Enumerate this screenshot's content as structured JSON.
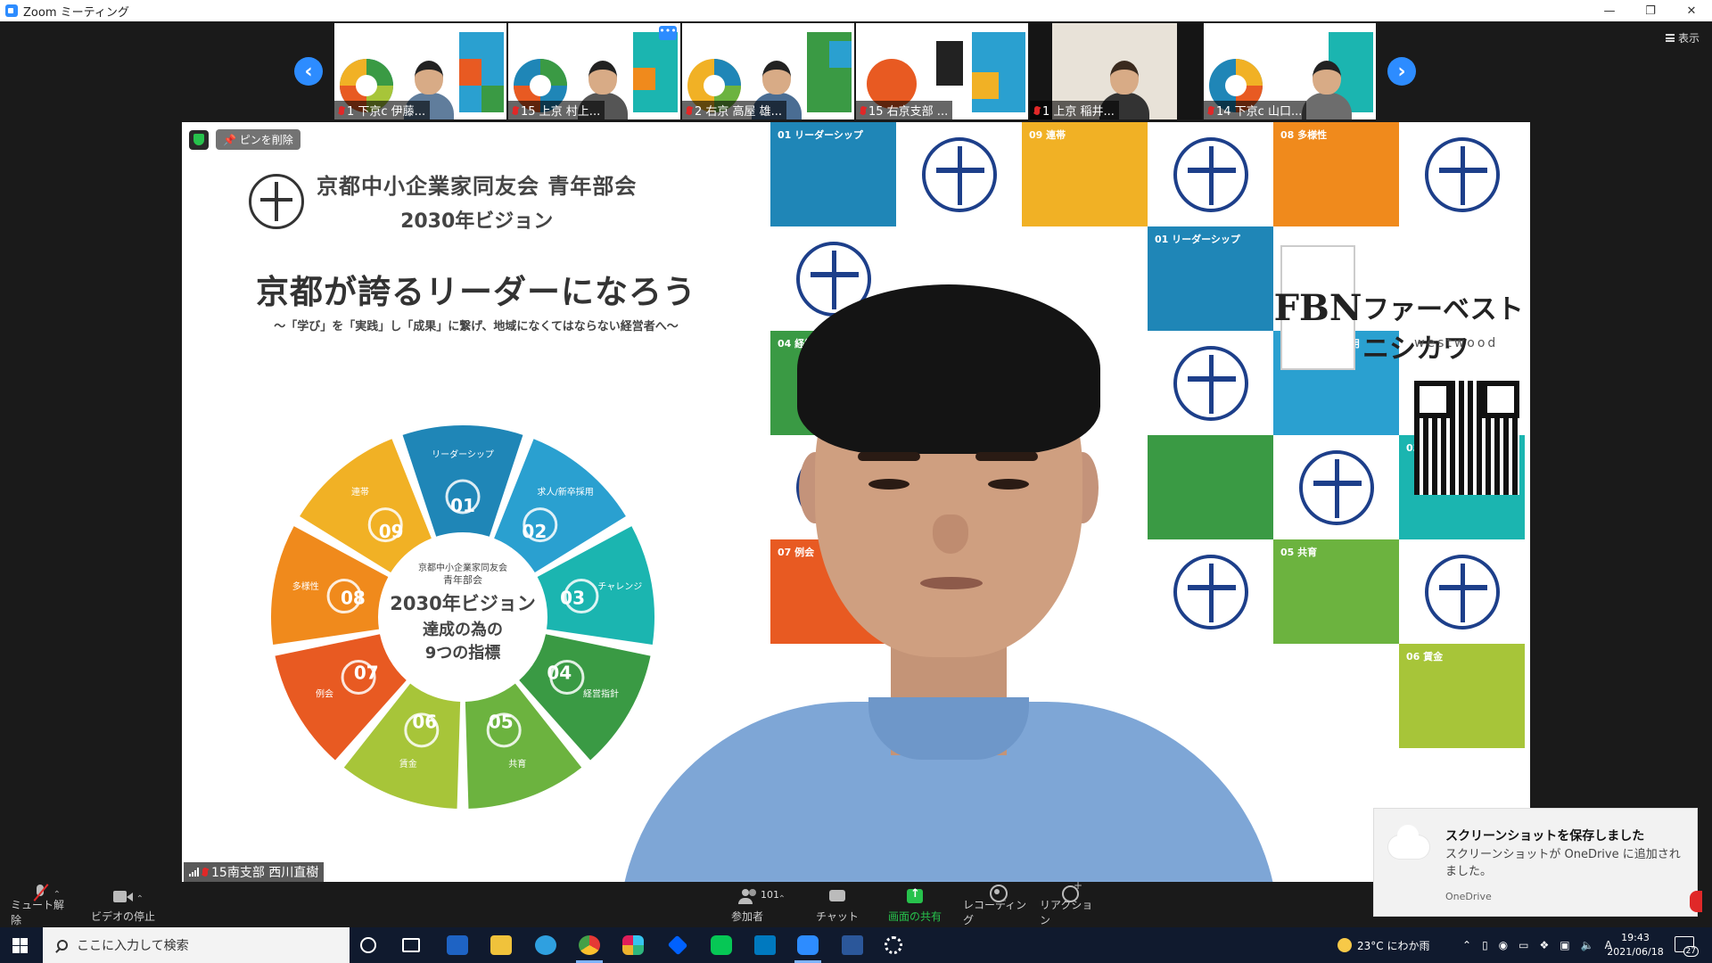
{
  "window": {
    "title": "Zoom ミーティング"
  },
  "view_button": {
    "label": "表示"
  },
  "thumbnails": [
    {
      "name": "1 下京c 伊藤..."
    },
    {
      "name": "15 上京 村上..."
    },
    {
      "name": "2 右京 高屋 雄..."
    },
    {
      "name": "15 右京支部 ..."
    },
    {
      "name": "1 上京 稲井..."
    },
    {
      "name": "14 下京c 山口..."
    }
  ],
  "main_video": {
    "unpin_label": "ピンを削除",
    "speaker_name": "15南支部 西川直樹",
    "slide": {
      "org_name": "京都中小企業家同友会 青年部会",
      "vision_title": "2030年ビジョン",
      "slogan": "京都が誇るリーダーになろう",
      "subslogan": "〜「学び」を「実践」し「成果」に繋げ、地域になくてはならない経営者へ〜",
      "wheel_center": [
        "京都中小企業家同友会",
        "青年部会",
        "2030年ビジョン",
        "達成の為の",
        "9つの指標"
      ],
      "wheel_segments": [
        {
          "num": "01",
          "label": "リーダーシップ",
          "color": "#1f86b7"
        },
        {
          "num": "02",
          "label": "求人/新卒採用",
          "color": "#2aa0d0"
        },
        {
          "num": "03",
          "label": "チャレンジ",
          "color": "#1bb5b0"
        },
        {
          "num": "04",
          "label": "経営指針",
          "color": "#3a9a44"
        },
        {
          "num": "05",
          "label": "共育",
          "color": "#6cb33f"
        },
        {
          "num": "06",
          "label": "賃金",
          "color": "#a7c539"
        },
        {
          "num": "07",
          "label": "例会",
          "color": "#e85a22"
        },
        {
          "num": "08",
          "label": "多様性",
          "color": "#f08a1c"
        },
        {
          "num": "09",
          "label": "連帯",
          "color": "#f1b125"
        }
      ],
      "tile_labels": [
        "01 リーダーシップ",
        "09 連帯",
        "08 多様性",
        "01 リーダーシップ",
        "02 求人/新卒採用",
        "04 経営",
        "03 チャレンジ",
        "07 例会",
        "05 共育",
        "06 賃金"
      ],
      "company_mark": "FBN",
      "company_name": "ファーベストニシカワ",
      "company_sub": "westwood"
    }
  },
  "toast": {
    "title": "スクリーンショットを保存しました",
    "body": "スクリーンショットが OneDrive に追加されました。",
    "app": "OneDrive"
  },
  "controls": {
    "mute_label": "ミュート解除",
    "video_label": "ビデオの停止",
    "participants_label": "参加者",
    "participants_count": "101",
    "chat_label": "チャット",
    "share_label": "画面の共有",
    "record_label": "レコーディング",
    "reaction_label": "リアクション"
  },
  "taskbar": {
    "search_placeholder": "ここに入力して検索",
    "weather": "23°C にわか雨",
    "ime": "A",
    "time": "19:43",
    "date": "2021/06/18",
    "notification_count": "27",
    "pinned_apps": [
      "task-view",
      "bw",
      "explorer",
      "edge",
      "chrome",
      "slack",
      "dropbox",
      "line",
      "trello",
      "zoom",
      "word",
      "settings"
    ]
  },
  "colors": {
    "zoom_blue": "#2d8cff",
    "share_green": "#27c24c",
    "mute_red": "#e02828",
    "dark_bg": "#1a1a1a",
    "taskbar_bg": "#101a2e"
  }
}
